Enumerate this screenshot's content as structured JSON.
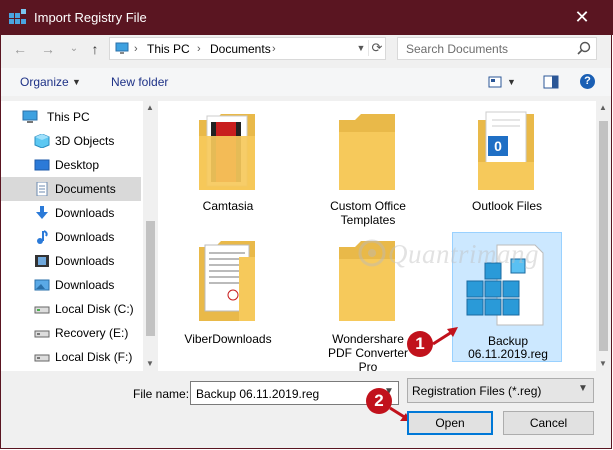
{
  "window": {
    "title": "Import Registry File",
    "close_glyph": "✕"
  },
  "nav": {
    "back_glyph": "←",
    "forward_glyph": "→",
    "up_glyph": "↑",
    "recent_glyph": "⌄",
    "breadcrumbs": [
      "This PC",
      "Documents"
    ],
    "search_placeholder": "Search Documents"
  },
  "toolbar": {
    "organize_label": "Organize",
    "new_folder_label": "New folder",
    "help_glyph": "?"
  },
  "sidebar": {
    "items": [
      {
        "label": "This PC",
        "icon": "pc-icon"
      },
      {
        "label": "3D Objects",
        "icon": "cube-icon"
      },
      {
        "label": "Desktop",
        "icon": "desktop-icon"
      },
      {
        "label": "Documents",
        "icon": "documents-icon"
      },
      {
        "label": "Downloads",
        "icon": "download-icon"
      },
      {
        "label": "Downloads",
        "icon": "music-icon"
      },
      {
        "label": "Downloads",
        "icon": "video-icon"
      },
      {
        "label": "Downloads",
        "icon": "pictures-icon"
      },
      {
        "label": "Local Disk (C:)",
        "icon": "drive-icon"
      },
      {
        "label": "Recovery (E:)",
        "icon": "drive-icon"
      },
      {
        "label": "Local Disk (F:)",
        "icon": "drive-icon"
      }
    ]
  },
  "files": [
    {
      "name": "Camtasia",
      "type": "folder"
    },
    {
      "name": "Custom Office Templates",
      "type": "folder"
    },
    {
      "name": "Outlook Files",
      "type": "folder"
    },
    {
      "name": "ViberDownloads",
      "type": "folder"
    },
    {
      "name": "Wondershare PDF Converter Pro",
      "type": "folder"
    },
    {
      "name": "Backup 06.11.2019.reg",
      "type": "registry-file"
    }
  ],
  "file_labels": {
    "camtasia": "Camtasia",
    "custom_1": "Custom Office",
    "custom_2": "Templates",
    "outlook": "Outlook Files",
    "viber": "ViberDownloads",
    "ws_1": "Wondershare",
    "ws_2": "PDF Converter",
    "ws_3": "Pro",
    "backup_1": "Backup",
    "backup_2": "06.11.2019.reg"
  },
  "bottom": {
    "file_name_label": "File name:",
    "file_name_value": "Backup 06.11.2019.reg",
    "filter_value": "Registration Files (*.reg)",
    "open_label": "Open",
    "cancel_label": "Cancel"
  },
  "callouts": {
    "step1": "1",
    "step2": "2"
  },
  "watermark": {
    "text": "Quantrimang"
  },
  "colors": {
    "titlebar": "#5a1521",
    "selection": "#cce8ff",
    "folder": "#f3c55b",
    "callout": "#c1121c",
    "focus_border": "#0078d7"
  }
}
